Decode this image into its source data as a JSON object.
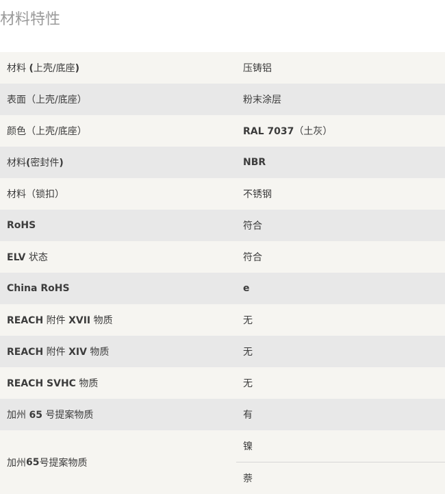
{
  "section": {
    "title": "材料特性"
  },
  "properties": [
    {
      "label_pre": "材料 ",
      "label_bold": "(",
      "label_post": "上壳/底座",
      "label_bold2": ")",
      "value": "压铸铝"
    },
    {
      "label": "表面（上壳/底座）",
      "value": "粉末涂层"
    },
    {
      "label": "颜色（上壳/底座）",
      "value_bold": "RAL 7037",
      "value_rest": "（土灰）"
    },
    {
      "label_pre": "材料",
      "label_bold": "(",
      "label_post": "密封件",
      "label_bold2": ")",
      "value_bold": "NBR"
    },
    {
      "label": "材料（锁扣）",
      "value": "不锈钢"
    },
    {
      "label_bold": "RoHS",
      "value": "符合"
    },
    {
      "label_bold": "ELV",
      "label_post": " 状态",
      "value": "符合"
    },
    {
      "label_bold": "China RoHS",
      "value_bold": "e"
    },
    {
      "label_bold": "REACH",
      "label_post": " 附件 ",
      "label_bold2": "XVII",
      "label_post2": " 物质",
      "value": "无"
    },
    {
      "label_bold": "REACH",
      "label_post": " 附件 ",
      "label_bold2": "XIV",
      "label_post2": " 物质",
      "value": "无"
    },
    {
      "label_bold": "REACH SVHC",
      "label_post": " 物质",
      "value": "无"
    },
    {
      "label_pre": "加州 ",
      "label_bold": "65",
      "label_post": " 号提案物质",
      "value": "有"
    }
  ],
  "last_property": {
    "label_pre": "加州 ",
    "label_bold": "65",
    "label_post": " 号提案物质",
    "values": [
      "镍",
      "萘"
    ]
  }
}
